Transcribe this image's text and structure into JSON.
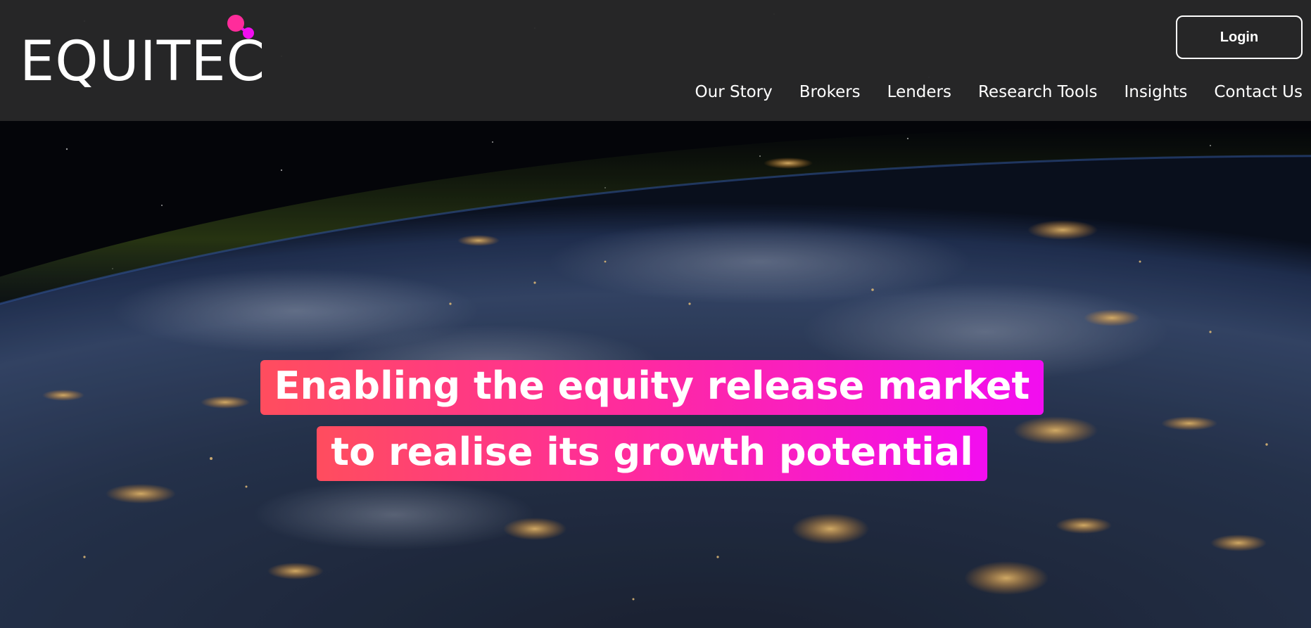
{
  "brand": {
    "name": "EQUITEC",
    "accent_colors": [
      "#ff2c9b",
      "#f20df0",
      "#ff4d5e"
    ]
  },
  "header": {
    "login_label": "Login",
    "nav": [
      {
        "label": "Our Story"
      },
      {
        "label": "Brokers"
      },
      {
        "label": "Lenders"
      },
      {
        "label": "Research Tools"
      },
      {
        "label": "Insights"
      },
      {
        "label": "Contact Us"
      }
    ]
  },
  "hero": {
    "headline_line1": "Enabling the equity release market",
    "headline_line2": "to realise its growth potential",
    "background": "earth-at-night-from-space"
  }
}
